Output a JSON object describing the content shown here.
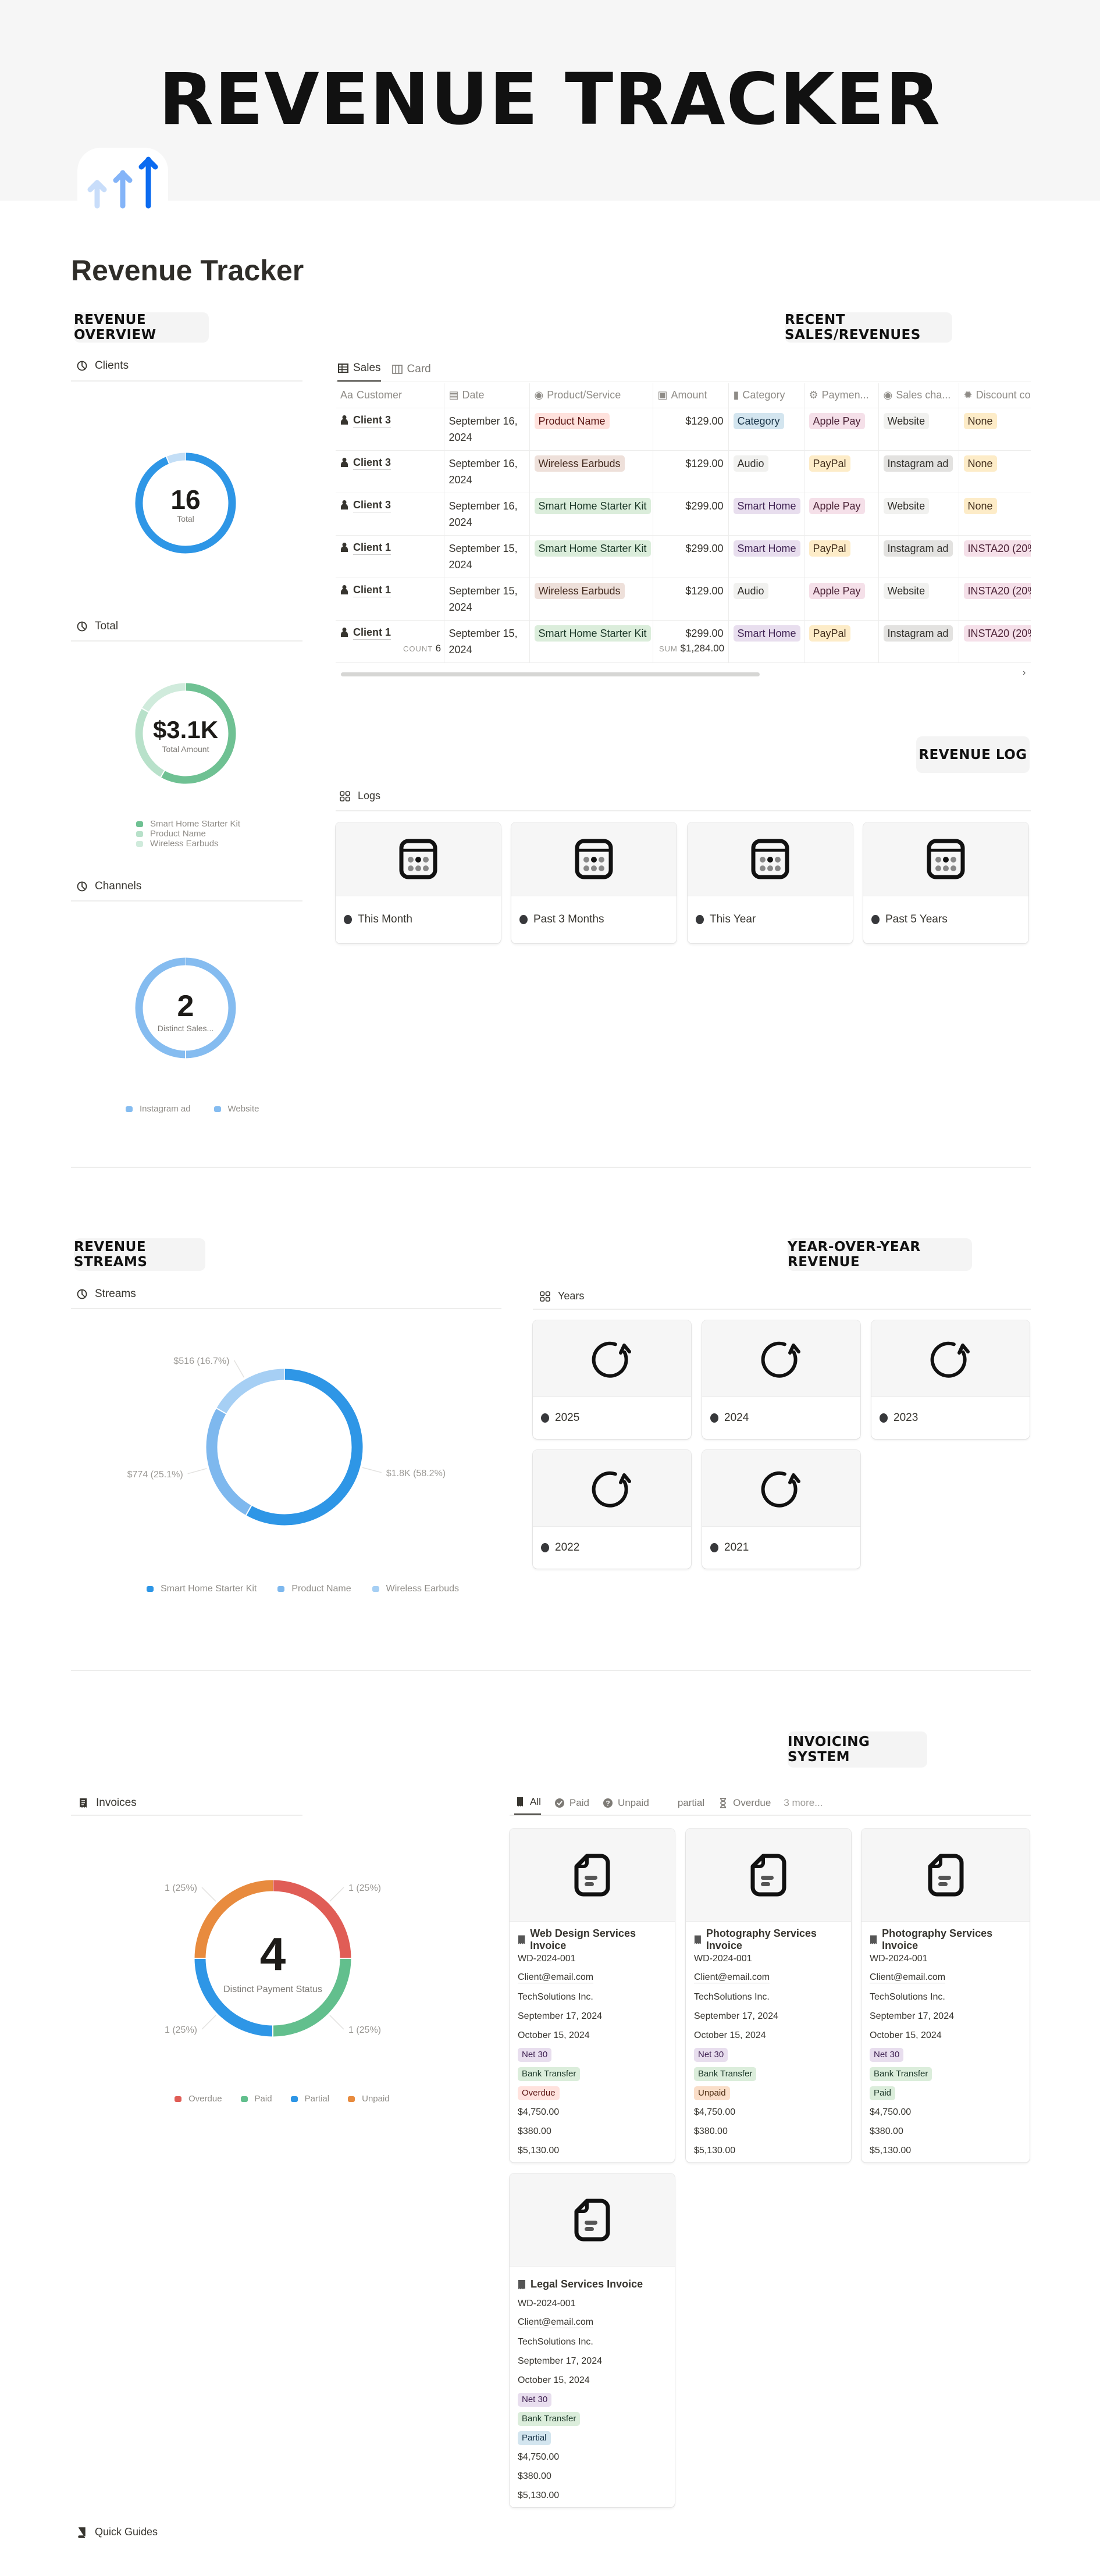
{
  "header": {
    "banner_title": "REVENUE TRACKER",
    "page_title": "Revenue Tracker",
    "icon": "rising-arrows-icon"
  },
  "overview": {
    "badge": "REVENUE OVERVIEW",
    "clients": {
      "label": "Clients"
    },
    "total": {
      "label": "Total"
    },
    "channels": {
      "label": "Channels"
    }
  },
  "sales": {
    "badge": "RECENT SALES/REVENUES",
    "tabs": [
      {
        "label": "Sales",
        "active": true
      },
      {
        "label": "Card",
        "active": false
      }
    ],
    "columns": [
      "Customer",
      "Date",
      "Product/Service",
      "Amount",
      "Category",
      "Paymen...",
      "Sales cha...",
      "Discount co"
    ],
    "rows": [
      {
        "customer": "Client 3",
        "date": "September 16, 2024",
        "product": "Product Name",
        "amount": "$129.00",
        "category": "Category",
        "payment": "Apple Pay",
        "channel": "Website",
        "discount": "None"
      },
      {
        "customer": "Client 3",
        "date": "September 16, 2024",
        "product": "Wireless Earbuds",
        "amount": "$129.00",
        "category": "Audio",
        "payment": "PayPal",
        "channel": "Instagram ad",
        "discount": "None"
      },
      {
        "customer": "Client 3",
        "date": "September 16, 2024",
        "product": "Smart Home Starter Kit",
        "amount": "$299.00",
        "category": "Smart Home",
        "payment": "Apple Pay",
        "channel": "Website",
        "discount": "None"
      },
      {
        "customer": "Client 1",
        "date": "September 15, 2024",
        "product": "Smart Home Starter Kit",
        "amount": "$299.00",
        "category": "Smart Home",
        "payment": "PayPal",
        "channel": "Instagram ad",
        "discount": "INSTA20 (20%"
      },
      {
        "customer": "Client 1",
        "date": "September 15, 2024",
        "product": "Wireless Earbuds",
        "amount": "$129.00",
        "category": "Audio",
        "payment": "Apple Pay",
        "channel": "Website",
        "discount": "INSTA20 (20%"
      },
      {
        "customer": "Client 1",
        "date": "September 15, 2024",
        "product": "Smart Home Starter Kit",
        "amount": "$299.00",
        "category": "Smart Home",
        "payment": "PayPal",
        "channel": "Instagram ad",
        "discount": "INSTA20 (20%"
      }
    ],
    "footer": {
      "count_label": "COUNT",
      "count": "6",
      "sum_label": "SUM",
      "sum": "$1,284.00"
    },
    "tag_colors": {
      "Product Name": [
        "#ffe2dd",
        "#5d1715"
      ],
      "Wireless Earbuds": [
        "#eee0da",
        "#442a1e"
      ],
      "Smart Home Starter Kit": [
        "#dbeddb",
        "#1c3829"
      ],
      "Category": [
        "#d3e5ef",
        "#183347"
      ],
      "Audio": [
        "#f1f1ef",
        "#32302c"
      ],
      "Smart Home": [
        "#e8deee",
        "#412454"
      ],
      "Apple Pay": [
        "#f5e0e9",
        "#4c2337"
      ],
      "PayPal": [
        "#fdecc8",
        "#402c1b"
      ],
      "Website": [
        "#f1f1ef",
        "#32302c"
      ],
      "Instagram ad": [
        "#e3e2e0",
        "#32302c"
      ],
      "None": [
        "#fdecc8",
        "#402c1b"
      ],
      "INSTA20 (20%": [
        "#f5e0e9",
        "#4c2337"
      ]
    }
  },
  "log": {
    "badge": "REVENUE LOG",
    "view_label": "Logs",
    "cards": [
      "This Month",
      "Past 3 Months",
      "This Year",
      "Past 5 Years"
    ],
    "card_icon": "calendar-icon"
  },
  "streams": {
    "badge": "REVENUE STREAMS",
    "view_label": "Streams"
  },
  "yoy": {
    "badge": "YEAR-OVER-YEAR REVENUE",
    "view_label": "Years",
    "cards": [
      "2025",
      "2024",
      "2023",
      "2022",
      "2021"
    ],
    "card_icon": "refresh-icon"
  },
  "invoicing": {
    "badge": "INVOICING SYSTEM",
    "view_label": "Invoices",
    "filters": [
      "All",
      "Paid",
      "Unpaid",
      "partial",
      "Overdue"
    ],
    "more": "3 more...",
    "cards": [
      {
        "title": "Web Design Services Invoice",
        "number": "WD-2024-001",
        "email": "Client@email.com",
        "company": "TechSolutions Inc.",
        "issued": "September 17, 2024",
        "due": "October 15, 2024",
        "terms": "Net 30",
        "method": "Bank Transfer",
        "status": "Overdue",
        "subtotal": "$4,750.00",
        "tax": "$380.00",
        "total": "$5,130.00"
      },
      {
        "title": "Photography Services Invoice",
        "number": "WD-2024-001",
        "email": "Client@email.com",
        "company": "TechSolutions Inc.",
        "issued": "September 17, 2024",
        "due": "October 15, 2024",
        "terms": "Net 30",
        "method": "Bank Transfer",
        "status": "Unpaid",
        "subtotal": "$4,750.00",
        "tax": "$380.00",
        "total": "$5,130.00"
      },
      {
        "title": "Photography Services Invoice",
        "number": "WD-2024-001",
        "email": "Client@email.com",
        "company": "TechSolutions Inc.",
        "issued": "September 17, 2024",
        "due": "October 15, 2024",
        "terms": "Net 30",
        "method": "Bank Transfer",
        "status": "Paid",
        "subtotal": "$4,750.00",
        "tax": "$380.00",
        "total": "$5,130.00"
      },
      {
        "title": "Legal Services Invoice",
        "number": "WD-2024-001",
        "email": "Client@email.com",
        "company": "TechSolutions Inc.",
        "issued": "September 17, 2024",
        "due": "October 15, 2024",
        "terms": "Net 30",
        "method": "Bank Transfer",
        "status": "Partial",
        "subtotal": "$4,750.00",
        "tax": "$380.00",
        "total": "$5,130.00"
      }
    ],
    "status_colors": {
      "Overdue": [
        "#ffe2dd",
        "#5d1715"
      ],
      "Unpaid": [
        "#fadec9",
        "#49290e"
      ],
      "Paid": [
        "#dbeddb",
        "#1c3829"
      ],
      "Partial": [
        "#d3e5ef",
        "#183347"
      ]
    },
    "terms_color": [
      "#e8deee",
      "#412454"
    ],
    "method_color": [
      "#dbeddb",
      "#1c3829"
    ]
  },
  "footer": {
    "quick_guides": "Quick Guides"
  },
  "chart_data": [
    {
      "id": "clients",
      "type": "pie",
      "donut": true,
      "center_value": "16",
      "center_label": "Total",
      "values": [
        15,
        1
      ],
      "colors": [
        "#2e96e6",
        "#c3def6"
      ]
    },
    {
      "id": "total",
      "type": "pie",
      "donut": true,
      "center_value": "$3.1K",
      "center_label": "Total Amount",
      "categories": [
        "Smart Home Starter Kit",
        "Product Name",
        "Wireless Earbuds"
      ],
      "values": [
        58.2,
        25.1,
        16.7
      ],
      "colors": [
        "#6fc193",
        "#b8e1ca",
        "#d0ebdc"
      ],
      "legend": "bottom"
    },
    {
      "id": "channels",
      "type": "pie",
      "donut": true,
      "center_value": "2",
      "center_label": "Distinct Sales...",
      "categories": [
        "Instagram ad",
        "Website"
      ],
      "values": [
        1,
        1
      ],
      "colors": [
        "#85bcf0",
        "#85bcf0"
      ],
      "legend": "bottom"
    },
    {
      "id": "streams",
      "type": "pie",
      "donut": true,
      "categories": [
        "Smart Home Starter Kit",
        "Product Name",
        "Wireless Earbuds"
      ],
      "values": [
        1794,
        774,
        516
      ],
      "data_labels": [
        "$1.8K (58.2%)",
        "$774 (25.1%)",
        "$516 (16.7%)"
      ],
      "colors": [
        "#2e96e6",
        "#7eb8ee",
        "#a6cff4"
      ],
      "legend": "bottom"
    },
    {
      "id": "invoices",
      "type": "pie",
      "donut": true,
      "center_value": "4",
      "center_label": "Distinct Payment Status",
      "categories": [
        "Overdue",
        "Paid",
        "Partial",
        "Unpaid"
      ],
      "values": [
        1,
        1,
        1,
        1
      ],
      "data_labels": [
        "1 (25%)",
        "1 (25%)",
        "1 (25%)",
        "1 (25%)"
      ],
      "colors": [
        "#e05d56",
        "#62bf8d",
        "#2e96e6",
        "#e88b3e"
      ],
      "legend": "bottom"
    }
  ]
}
